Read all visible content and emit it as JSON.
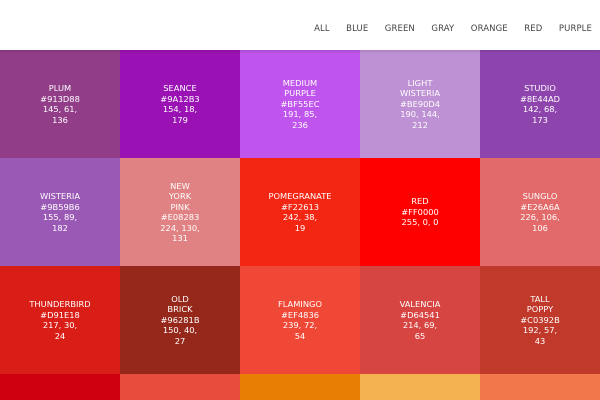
{
  "nav": [
    "ALL",
    "BLUE",
    "GREEN",
    "GRAY",
    "ORANGE",
    "RED",
    "PURPLE"
  ],
  "tiles": [
    {
      "name": [
        "PLUM"
      ],
      "hex": "#913D88",
      "rgb": [
        "145, 61,",
        "136"
      ],
      "color": "#913D88"
    },
    {
      "name": [
        "SEANCE"
      ],
      "hex": "#9A12B3",
      "rgb": [
        "154, 18,",
        "179"
      ],
      "color": "#9A12B3"
    },
    {
      "name": [
        "MEDIUM",
        "PURPLE"
      ],
      "hex": "#BF55EC",
      "rgb": [
        "191, 85,",
        "236"
      ],
      "color": "#BF55EC"
    },
    {
      "name": [
        "LIGHT",
        "WISTERIA"
      ],
      "hex": "#BE90D4",
      "rgb": [
        "190, 144,",
        "212"
      ],
      "color": "#BE90D4"
    },
    {
      "name": [
        "STUDIO"
      ],
      "hex": "#8E44AD",
      "rgb": [
        "142, 68,",
        "173"
      ],
      "color": "#8E44AD"
    },
    {
      "name": [
        "WISTERIA"
      ],
      "hex": "#9B59B6",
      "rgb": [
        "155, 89,",
        "182"
      ],
      "color": "#9B59B6"
    },
    {
      "name": [
        "NEW",
        "YORK",
        "PINK"
      ],
      "hex": "#E08283",
      "rgb": [
        "224, 130,",
        "131"
      ],
      "color": "#E08283"
    },
    {
      "name": [
        "POMEGRANATE"
      ],
      "hex": "#F22613",
      "rgb": [
        "242, 38,",
        "19"
      ],
      "color": "#F22613"
    },
    {
      "name": [
        "RED"
      ],
      "hex": "#FF0000",
      "rgb": [
        "255, 0, 0"
      ],
      "color": "#FF0000"
    },
    {
      "name": [
        "SUNGLO"
      ],
      "hex": "#E26A6A",
      "rgb": [
        "226, 106,",
        "106"
      ],
      "color": "#E26A6A"
    },
    {
      "name": [
        "THUNDERBIRD"
      ],
      "hex": "#D91E18",
      "rgb": [
        "217, 30,",
        "24"
      ],
      "color": "#D91E18"
    },
    {
      "name": [
        "OLD",
        "BRICK"
      ],
      "hex": "#96281B",
      "rgb": [
        "150, 40,",
        "27"
      ],
      "color": "#96281B"
    },
    {
      "name": [
        "FLAMINGO"
      ],
      "hex": "#EF4836",
      "rgb": [
        "239, 72,",
        "54"
      ],
      "color": "#EF4836"
    },
    {
      "name": [
        "VALENCIA"
      ],
      "hex": "#D64541",
      "rgb": [
        "214, 69,",
        "65"
      ],
      "color": "#D64541"
    },
    {
      "name": [
        "TALL",
        "POPPY"
      ],
      "hex": "#C0392B",
      "rgb": [
        "192, 57,",
        "43"
      ],
      "color": "#C0392B"
    }
  ],
  "partial_row_colors": [
    "#CF000F",
    "#E74C3C",
    "#E87E04",
    "#F4B350",
    "#F2784B"
  ]
}
